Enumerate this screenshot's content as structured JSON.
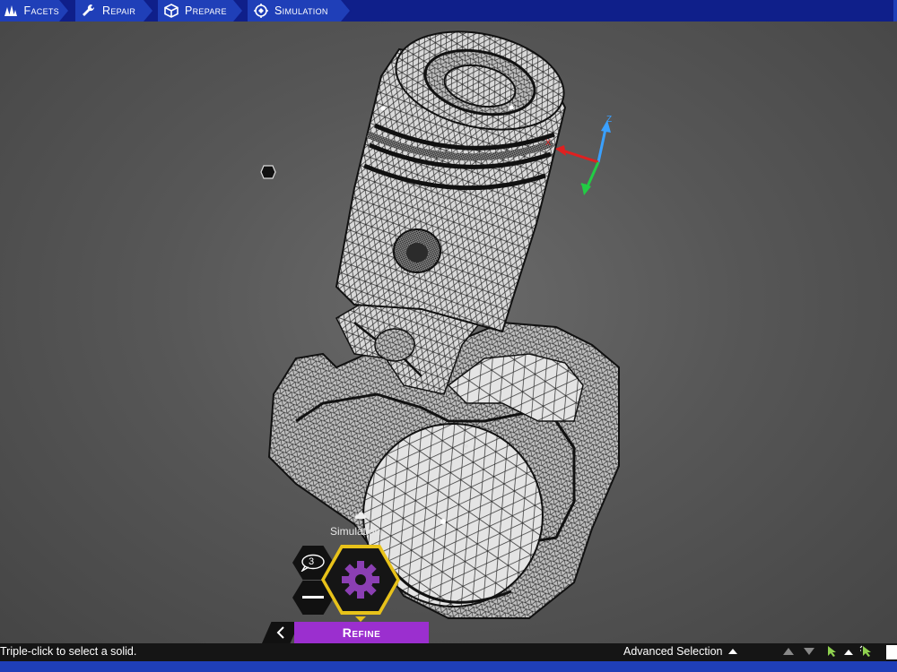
{
  "tabs": [
    {
      "label": "Facets",
      "icon": "facets-icon"
    },
    {
      "label": "Repair",
      "icon": "wrench-icon"
    },
    {
      "label": "Prepare",
      "icon": "cube-icon"
    },
    {
      "label": "Simulation",
      "icon": "simulation-icon"
    }
  ],
  "axis": {
    "z": "Z",
    "y": "Y",
    "x": "X"
  },
  "hex_menu": {
    "section_label": "Simulation",
    "badge_count": "3",
    "active_label": "Refine"
  },
  "status": {
    "hint": "Triple-click to select a solid.",
    "advanced_selection": "Advanced Selection"
  },
  "colors": {
    "ribbon": "#1f3fb8",
    "refine_accent": "#9b2fcf",
    "hex_highlight": "#e8c21a",
    "gear": "#8b3fb3"
  }
}
